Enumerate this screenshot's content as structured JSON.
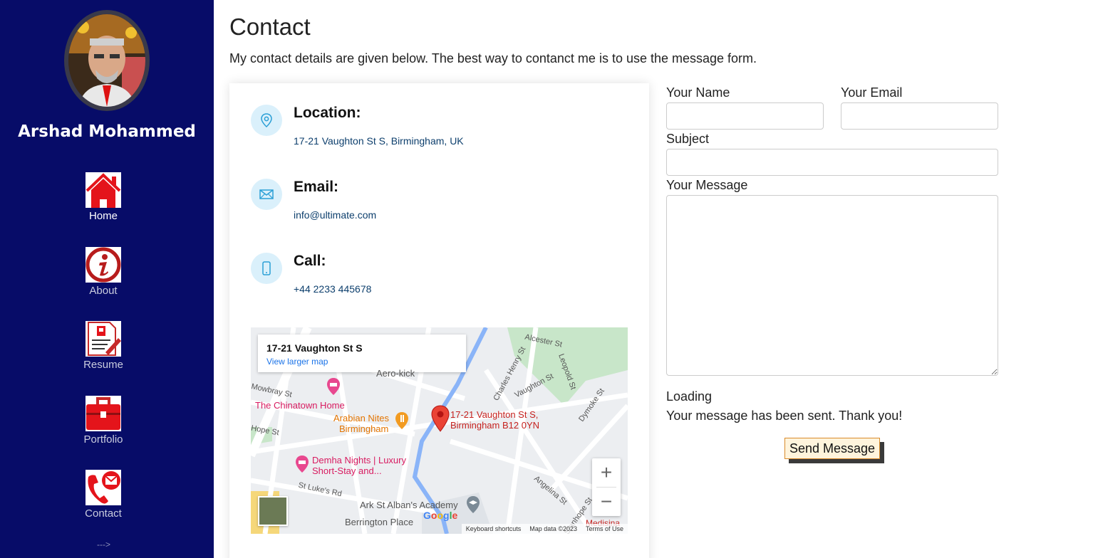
{
  "sidebar": {
    "name": "Arshad Mohammed",
    "nav": [
      {
        "label": "Home"
      },
      {
        "label": "About"
      },
      {
        "label": "Resume"
      },
      {
        "label": "Portfolio"
      },
      {
        "label": "Contact"
      }
    ],
    "more": "--->"
  },
  "main": {
    "title": "Contact",
    "intro": "My contact details are given below. The best way to contanct me is to use the message form."
  },
  "info": {
    "location": {
      "title": "Location:",
      "text": "17-21 Vaughton St S, Birmingham, UK"
    },
    "email": {
      "title": "Email:",
      "text": "info@ultimate.com"
    },
    "call": {
      "title": "Call:",
      "text": "+44 2233 445678"
    }
  },
  "map": {
    "popup_title": "17-21 Vaughton St S",
    "popup_link": "View larger map",
    "pin_label_1": "17-21 Vaughton St S,",
    "pin_label_2": "Birmingham B12 0YN",
    "places": {
      "chinatown": "The Chinatown Home",
      "arabian_1": "Arabian Nites",
      "arabian_2": "Birmingham",
      "demha_1": "Demha Nights | Luxury",
      "demha_2": "Short-Stay and...",
      "ark": "Ark St Alban's Academy",
      "berrington": "Berrington Place",
      "aero": "Aero-kick",
      "medisina": "Medisina"
    },
    "streets": {
      "mowbray": "Mowbray St",
      "hope": "Hope St",
      "st_lukes": "St Luke's Rd",
      "alcester": "Alcester St",
      "charles_henry": "Charles Henry St",
      "vaughton": "Vaughton St",
      "leopold": "Leopold St",
      "dymoke": "Dymoke St",
      "angelina": "Angelina St",
      "stanhope": "Stanhope St"
    },
    "zoom_in": "+",
    "zoom_out": "−",
    "google": "Google",
    "attribution": {
      "shortcuts": "Keyboard shortcuts",
      "data": "Map data ©2023",
      "terms": "Terms of Use"
    }
  },
  "form": {
    "name_label": "Your Name",
    "email_label": "Your Email",
    "subject_label": "Subject",
    "message_label": "Your Message",
    "name_value": "",
    "email_value": "",
    "subject_value": "",
    "message_value": "",
    "loading": "Loading",
    "sent": "Your message has been sent. Thank you!",
    "send_label": "Send Message"
  },
  "colors": {
    "sidebar_bg": "#070c68",
    "accent_icon_bg": "#daf0fb",
    "icon_red": "#e4141b",
    "button_bg": "#fff4dc",
    "button_border": "#d98a2a"
  },
  "icons": {
    "location": "map-pin-icon",
    "email": "envelope-icon",
    "call": "phone-icon"
  }
}
